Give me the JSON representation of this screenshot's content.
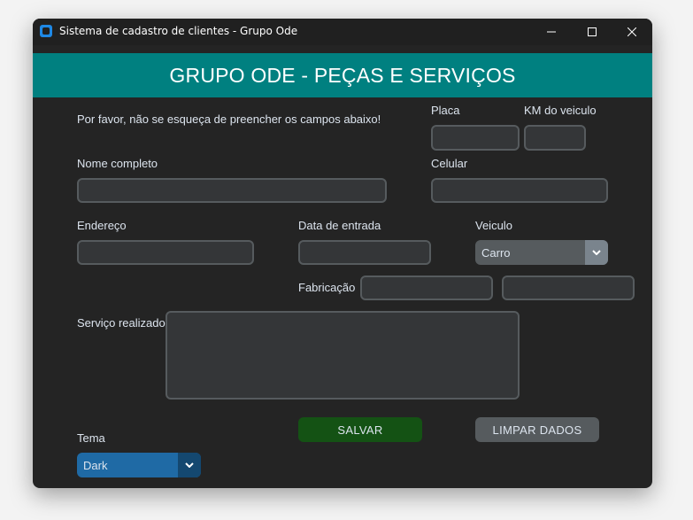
{
  "window": {
    "title": "Sistema de cadastro de clientes - Grupo Ode",
    "controls": [
      "minimize-icon",
      "maximize-icon",
      "close-icon"
    ]
  },
  "header": {
    "title": "GRUPO ODE - PEÇAS E SERVIÇOS"
  },
  "form": {
    "notice": "Por favor, não se esqueça de preencher os campos abaixo!",
    "placa_label": "Placa",
    "placa_value": "",
    "km_label": "KM do veiculo",
    "km_value": "",
    "nome_label": "Nome completo",
    "nome_value": "",
    "celular_label": "Celular",
    "celular_value": "",
    "endereco_label": "Endereço",
    "endereco_value": "",
    "data_label": "Data de entrada",
    "data_value": "",
    "veiculo_label": "Veiculo",
    "veiculo_value": "Carro",
    "fabricacao_label": "Fabricação",
    "fabricacao_value_1": "",
    "fabricacao_value_2": "",
    "servico_label": "Serviço realizado",
    "servico_value": ""
  },
  "buttons": {
    "save_label": "SALVAR",
    "clear_label": "LIMPAR DADOS"
  },
  "theme": {
    "label": "Tema",
    "value": "Dark"
  },
  "colors": {
    "header_band": "#008080",
    "window_bg": "#242424",
    "save_button": "#145214",
    "clear_button": "#565b5e",
    "theme_combo": "#1f6aa5",
    "theme_combo_arrow": "#144870",
    "veiculo_combo": "#565b5e",
    "veiculo_combo_arrow": "#7a848d"
  }
}
